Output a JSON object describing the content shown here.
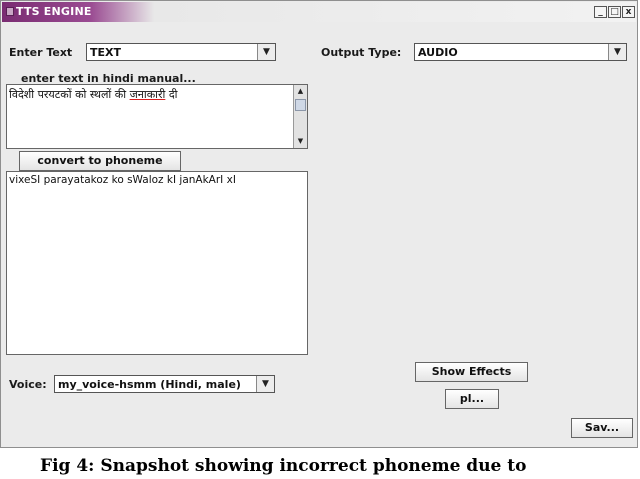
{
  "window": {
    "title": "TTS ENGINE",
    "controls": [
      "_",
      "□",
      "x"
    ]
  },
  "input": {
    "label": "Enter Text",
    "type_value": "TEXT",
    "manual_label": "enter text in hindi manual...",
    "hindi_text_plain": "विदेशी परयटकों को स्थलों की ",
    "hindi_text_marked": "जनाकारी",
    "hindi_text_end": " दी"
  },
  "convert": {
    "button_label": "convert to phoneme",
    "phoneme_text": "vixeSI parayatakoz ko sWaloz kI janAkArI xI"
  },
  "output": {
    "label": "Output Type:",
    "value": "AUDIO"
  },
  "voice": {
    "label": "Voice:",
    "value": "my_voice-hsmm (Hindi, male)"
  },
  "buttons": {
    "show_effects": "Show Effects",
    "play": "pl...",
    "save": "Sav..."
  },
  "caption": "Fig 4: Snapshot showing incorrect phoneme due to"
}
